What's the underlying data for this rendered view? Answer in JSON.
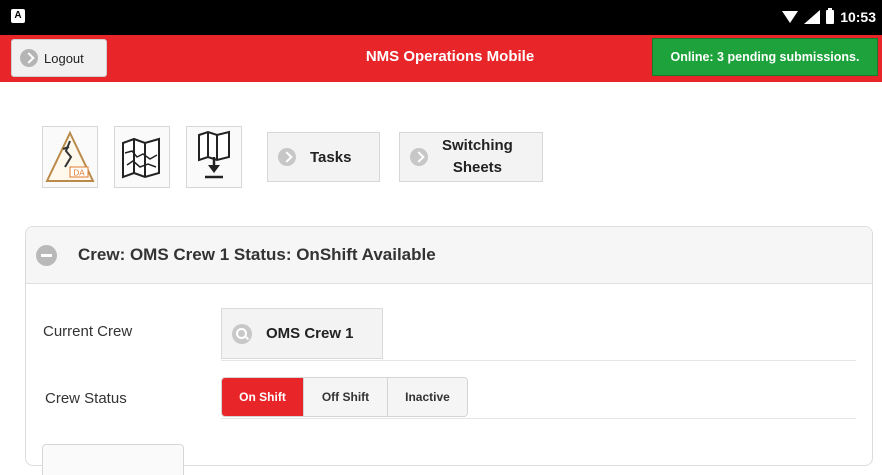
{
  "statusbar": {
    "time": "10:53"
  },
  "header": {
    "logout_label": "Logout",
    "title": "NMS Operations Mobile",
    "online_status": "Online: 3 pending submissions."
  },
  "toolbar": {
    "icons": [
      "damage-assessment-icon",
      "map-icon",
      "map-download-icon"
    ],
    "da_label": "DA",
    "tasks_label": "Tasks",
    "switching_line1": "Switching",
    "switching_line2": "Sheets"
  },
  "crew": {
    "header_title": "Crew: OMS Crew 1 Status: OnShift Available",
    "current_crew_label": "Current Crew",
    "current_crew_value": "OMS Crew 1",
    "crew_status_label": "Crew Status",
    "status_options": [
      "On Shift",
      "Off Shift",
      "Inactive"
    ],
    "selected_status": "On Shift"
  },
  "colors": {
    "brand_red": "#e8262a",
    "online_green": "#1ea33c"
  }
}
